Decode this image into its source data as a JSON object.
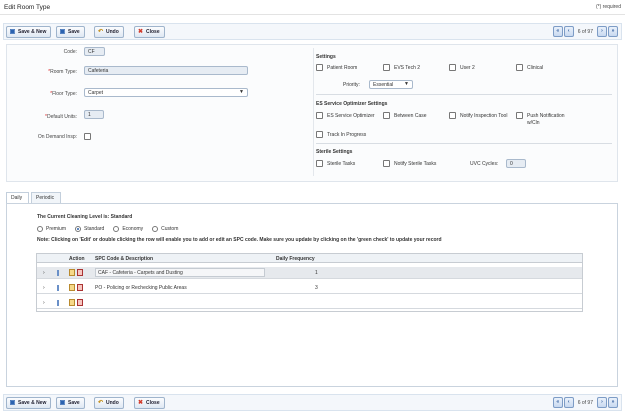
{
  "window": {
    "title": "Edit Room Type",
    "required_note": "(*) required"
  },
  "toolbar": {
    "save_new": "Save & New",
    "save": "Save",
    "undo": "Undo",
    "close": "Close",
    "page_info": "6 of 97"
  },
  "form": {
    "code_label": "Code:",
    "code_value": "CF",
    "room_type_label": "Room Type:",
    "room_type_value": "Cafeteria",
    "floor_type_label": "Floor Type:",
    "floor_type_value": "Carpet",
    "default_units_label": "Default Units:",
    "default_units_value": "1",
    "on_demand_label": "On Demand Insp:"
  },
  "settings": {
    "title": "Settings",
    "patient_room": "Patient Room",
    "evs_tech2": "EVS Tech 2",
    "user2": "User 2",
    "clinical": "Clinical",
    "priority_label": "Priority:",
    "priority_value": "Essential"
  },
  "optimizer": {
    "title": "ES Service Optimizer Settings",
    "es_optimizer": "ES Service Optimizer",
    "between_case": "Between Case",
    "notify_tool": "Notify Inspection Tool",
    "push_notification": "Push Notification w/Cln",
    "track_progress": "Track In Progress"
  },
  "sterile": {
    "title": "Sterile Settings",
    "sterile_tasks": "Sterile Tasks",
    "notify_sterile": "Notify Sterile Tasks",
    "uvc_label": "UVC Cycles:",
    "uvc_value": "0"
  },
  "tabs": {
    "daily": "Daily",
    "periodic": "Periodic"
  },
  "cleaning": {
    "level_text": "The Current Cleaning Level is: Standard",
    "premium": "Premium",
    "standard": "Standard",
    "economy": "Economy",
    "custom": "Custom",
    "note": "Note: Clicking on 'Edit' or double clicking the row will enable you to add or edit an SPC code. Make sure you update by clicking on the 'green check' to update your record"
  },
  "grid": {
    "col_action": "Action",
    "col_spc": "SPC Code & Description",
    "col_freq": "Daily Frequency",
    "rows": [
      {
        "spc": "CAF - Cafeteria - Carpets and Dusting",
        "freq": "1"
      },
      {
        "spc": "PO - Policing or Rechecking Public Areas",
        "freq": "3"
      },
      {
        "spc": "",
        "freq": ""
      }
    ]
  },
  "colors": {
    "accent": "#2b5fa8",
    "toolbar_bg": "#f4f7fb",
    "row_alt": "#e6e9ed"
  },
  "icons": [
    "save-new-icon",
    "save-icon",
    "undo-icon",
    "close-icon",
    "first-page-icon",
    "prev-page-icon",
    "next-page-icon",
    "last-page-icon",
    "expand-icon",
    "edit-icon",
    "delete-icon"
  ]
}
